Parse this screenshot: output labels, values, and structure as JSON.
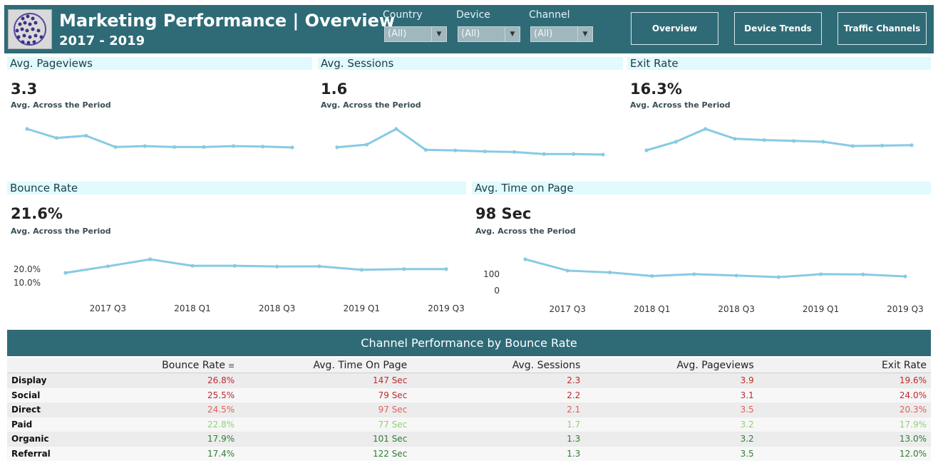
{
  "header": {
    "title": "Marketing Performance | Overview",
    "subtitle": "2017 - 2019",
    "filters": [
      {
        "label": "Country",
        "value": "(All)"
      },
      {
        "label": "Device",
        "value": "(All)"
      },
      {
        "label": "Channel",
        "value": "(All)"
      }
    ],
    "nav": [
      "Overview",
      "Device Trends",
      "Traffic Channels"
    ]
  },
  "kpis": {
    "pageviews": {
      "title": "Avg. Pageviews",
      "value": "3.3",
      "sub": "Avg. Across the Period"
    },
    "sessions": {
      "title": "Avg. Sessions",
      "value": "1.6",
      "sub": "Avg. Across the Period"
    },
    "exit": {
      "title": "Exit Rate",
      "value": "16.3%",
      "sub": "Avg. Across the Period"
    },
    "bounce": {
      "title": "Bounce Rate",
      "value": "21.6%",
      "sub": "Avg. Across the Period",
      "ticks": [
        "20.0%",
        "10.0%"
      ]
    },
    "time": {
      "title": "Avg. Time on Page",
      "value": "98 Sec",
      "sub": "Avg. Across the Period",
      "ticks": [
        "100",
        "0"
      ]
    }
  },
  "x_ticks": [
    "2017 Q3",
    "2018 Q1",
    "2018 Q3",
    "2019 Q1",
    "2019 Q3"
  ],
  "chart_data": [
    {
      "type": "line",
      "series": [
        {
          "values": [
            3.6,
            3.4,
            3.45,
            3.2,
            3.22,
            3.2,
            3.2,
            3.22,
            3.21,
            3.19
          ]
        }
      ]
    },
    {
      "type": "line",
      "series": [
        {
          "values": [
            1.5,
            1.55,
            1.85,
            1.45,
            1.44,
            1.42,
            1.41,
            1.37,
            1.37,
            1.36
          ]
        }
      ]
    },
    {
      "type": "line",
      "series": [
        {
          "values": [
            14.5,
            16.5,
            19.5,
            17.2,
            16.9,
            16.7,
            16.5,
            15.5,
            15.6,
            15.7
          ]
        }
      ]
    },
    {
      "type": "line",
      "xlabels": [
        "2017 Q3",
        "2018 Q1",
        "2018 Q3",
        "2019 Q1",
        "2019 Q3"
      ],
      "yticks": [
        "20.0%",
        "10.0%"
      ],
      "series": [
        {
          "values": [
            19.0,
            21.8,
            24.8,
            22.0,
            22.0,
            21.7,
            21.8,
            20.3,
            20.6,
            20.6
          ]
        }
      ]
    },
    {
      "type": "line",
      "xlabels": [
        "2017 Q3",
        "2018 Q1",
        "2018 Q3",
        "2019 Q1",
        "2019 Q3"
      ],
      "yticks": [
        "100",
        "0"
      ],
      "series": [
        {
          "values": [
            177,
            126,
            118,
            102,
            110,
            104,
            97,
            110,
            109,
            100
          ]
        }
      ]
    }
  ],
  "table": {
    "title": "Channel Performance by Bounce Rate",
    "columns": [
      "",
      "Bounce Rate",
      "Avg. Time On Page",
      "Avg. Sessions",
      "Avg. Pageviews",
      "Exit Rate"
    ],
    "rows": [
      {
        "name": "Display",
        "cells": [
          "26.8%",
          "147 Sec",
          "2.3",
          "3.9",
          "19.6%"
        ],
        "color": "#c1272d"
      },
      {
        "name": "Social",
        "cells": [
          "25.5%",
          "79 Sec",
          "2.2",
          "3.1",
          "24.0%"
        ],
        "color": "#c1272d"
      },
      {
        "name": "Direct",
        "cells": [
          "24.5%",
          "97 Sec",
          "2.1",
          "3.5",
          "20.3%"
        ],
        "color": "#e0605a"
      },
      {
        "name": "Paid",
        "cells": [
          "22.8%",
          "77 Sec",
          "1.7",
          "3.2",
          "17.9%"
        ],
        "color": "#8fd175"
      },
      {
        "name": "Organic",
        "cells": [
          "17.9%",
          "101 Sec",
          "1.3",
          "3.2",
          "13.0%"
        ],
        "color": "#2e7d32"
      },
      {
        "name": "Referral",
        "cells": [
          "17.4%",
          "122 Sec",
          "1.3",
          "3.5",
          "12.0%"
        ],
        "color": "#2e7d32"
      }
    ]
  },
  "colors": {
    "header_bg": "#2e6b77",
    "title_band": "#e0fafd",
    "line": "#87cae4"
  }
}
